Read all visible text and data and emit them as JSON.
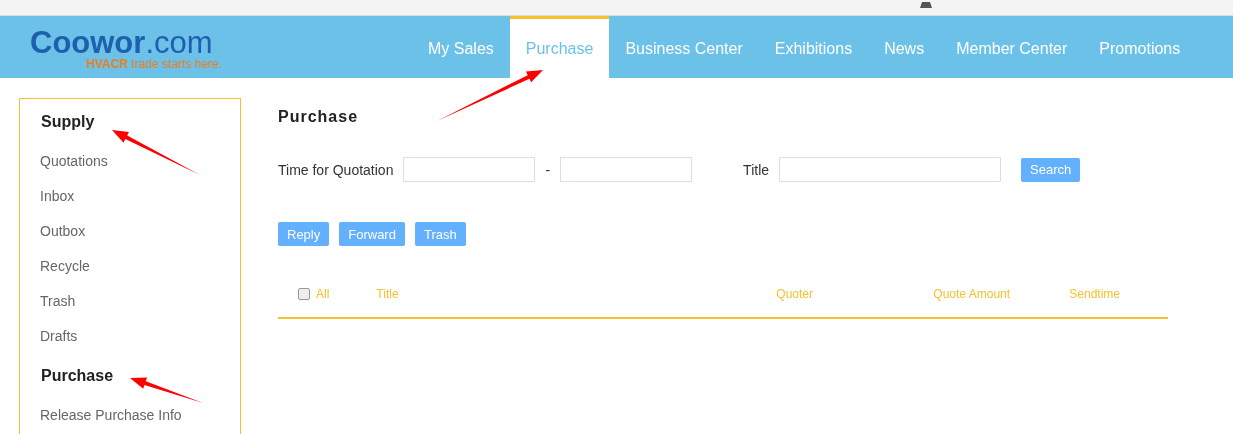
{
  "logo": {
    "name": "**Coowor**.com",
    "tagline": "**HVACR** trade starts here."
  },
  "nav": [
    {
      "label": "My Sales",
      "selected": false
    },
    {
      "label": "Purchase",
      "selected": true
    },
    {
      "label": "Business Center",
      "selected": false
    },
    {
      "label": "Exhibitions",
      "selected": false
    },
    {
      "label": "News",
      "selected": false
    },
    {
      "label": "Member Center",
      "selected": false
    },
    {
      "label": "Promotions",
      "selected": false
    }
  ],
  "sidebar": {
    "sections": [
      {
        "title": "Supply",
        "items": [
          "Quotations",
          "Inbox",
          "Outbox",
          "Recycle",
          "Trash",
          "Drafts"
        ]
      },
      {
        "title": "Purchase",
        "items": [
          "Release Purchase Info"
        ]
      }
    ]
  },
  "page_title": "Purchase",
  "filters": {
    "time_label": "Time for Quotation",
    "range_separator": "-",
    "title_label": "Title",
    "search_button": "Search"
  },
  "actions": [
    "Reply",
    "Forward",
    "Trash"
  ],
  "table": {
    "select_all": {
      "label": "All",
      "checked": false
    },
    "columns": [
      "Title",
      "Quoter",
      "Quote Amount",
      "Sendtime"
    ]
  }
}
